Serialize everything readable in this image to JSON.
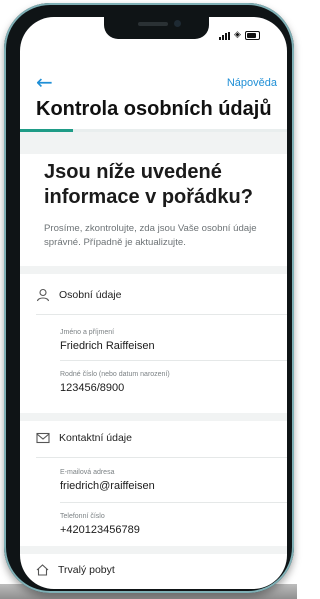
{
  "nav": {
    "back_icon": "arrow-left-icon",
    "help_label": "Nápověda"
  },
  "page": {
    "title": "Kontrola osobních údajů",
    "progress_fraction": 0.2
  },
  "intro": {
    "headline": "Jsou níže uvedené informace v pořádku?",
    "description": "Prosíme, zkontrolujte, zda jsou Vaše osobní údaje správné. Případně je aktualizujte."
  },
  "sections": {
    "personal": {
      "title": "Osobní údaje",
      "icon": "person-icon",
      "fields": [
        {
          "label": "Jméno a příjmení",
          "value": "Friedrich Raiffeisen"
        },
        {
          "label": "Rodné číslo (nebo datum narození)",
          "value": "123456/8900"
        }
      ]
    },
    "contact": {
      "title": "Kontaktní údaje",
      "icon": "envelope-icon",
      "fields": [
        {
          "label": "E-mailová adresa",
          "value": "friedrich@raiffeisen"
        },
        {
          "label": "Telefonní číslo",
          "value": "+420123456789"
        }
      ]
    },
    "residence": {
      "title": "Trvalý pobyt",
      "icon": "home-icon"
    }
  },
  "colors": {
    "accent": "#1f8fd6",
    "progress": "#1f9c87",
    "phone_frame": "#0f1416"
  }
}
